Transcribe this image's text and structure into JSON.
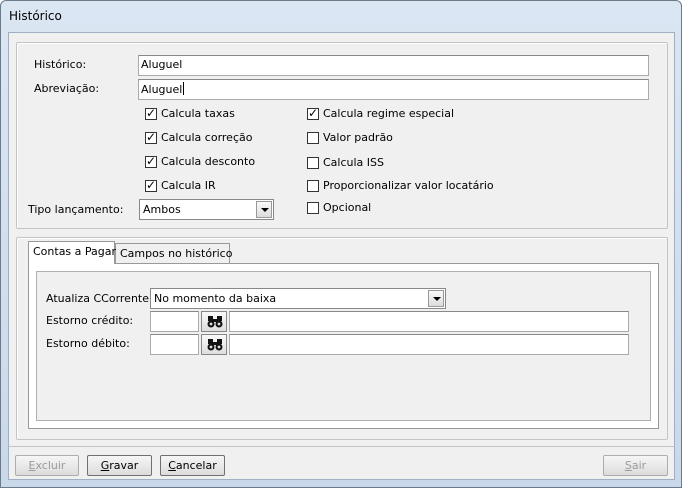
{
  "window": {
    "title": "Histórico"
  },
  "form": {
    "historico_label": "Histórico:",
    "historico_value": "Aluguel",
    "abreviacao_label": "Abreviação:",
    "abreviacao_value": "Aluguel",
    "tipo_label": "Tipo lançamento:",
    "tipo_value": "Ambos",
    "checkboxes_left": [
      {
        "label": "Calcula taxas",
        "checked": true
      },
      {
        "label": "Calcula correção",
        "checked": true
      },
      {
        "label": "Calcula desconto",
        "checked": true
      },
      {
        "label": "Calcula IR",
        "checked": true
      }
    ],
    "checkboxes_right": [
      {
        "label": "Calcula regime especial",
        "checked": true
      },
      {
        "label": "Valor padrão",
        "checked": false
      },
      {
        "label": "Calcula ISS",
        "checked": false
      },
      {
        "label": "Proporcionalizar valor locatário",
        "checked": false
      },
      {
        "label": "Opcional",
        "checked": false
      }
    ]
  },
  "tabs": [
    {
      "label": "Contas a Pagar",
      "active": true
    },
    {
      "label": "Campos no histórico",
      "active": false
    }
  ],
  "contas": {
    "atualiza_label": "Atualiza CCorrente:",
    "atualiza_value": "No momento da baixa",
    "estorno_credito_label": "Estorno crédito:",
    "estorno_debito_label": "Estorno débito:",
    "estorno_credito_code": "",
    "estorno_credito_desc": "",
    "estorno_debito_code": "",
    "estorno_debito_desc": ""
  },
  "buttons": {
    "excluir": {
      "first": "E",
      "rest": "xcluir",
      "enabled": false
    },
    "gravar": {
      "first": "G",
      "rest": "ravar",
      "enabled": true
    },
    "cancelar": {
      "first": "C",
      "rest": "ancelar",
      "enabled": true
    },
    "sair": {
      "first": "S",
      "rest": "air",
      "enabled": false
    }
  },
  "icons": {
    "search": "binoculars-icon",
    "dropdown": "chevron-down-icon",
    "checkbox": "checkmark-icon"
  },
  "colors": {
    "tab_underline": "#cc1111",
    "window_frame": "#c9d8ea",
    "client_bg": "#f0f0f0"
  }
}
